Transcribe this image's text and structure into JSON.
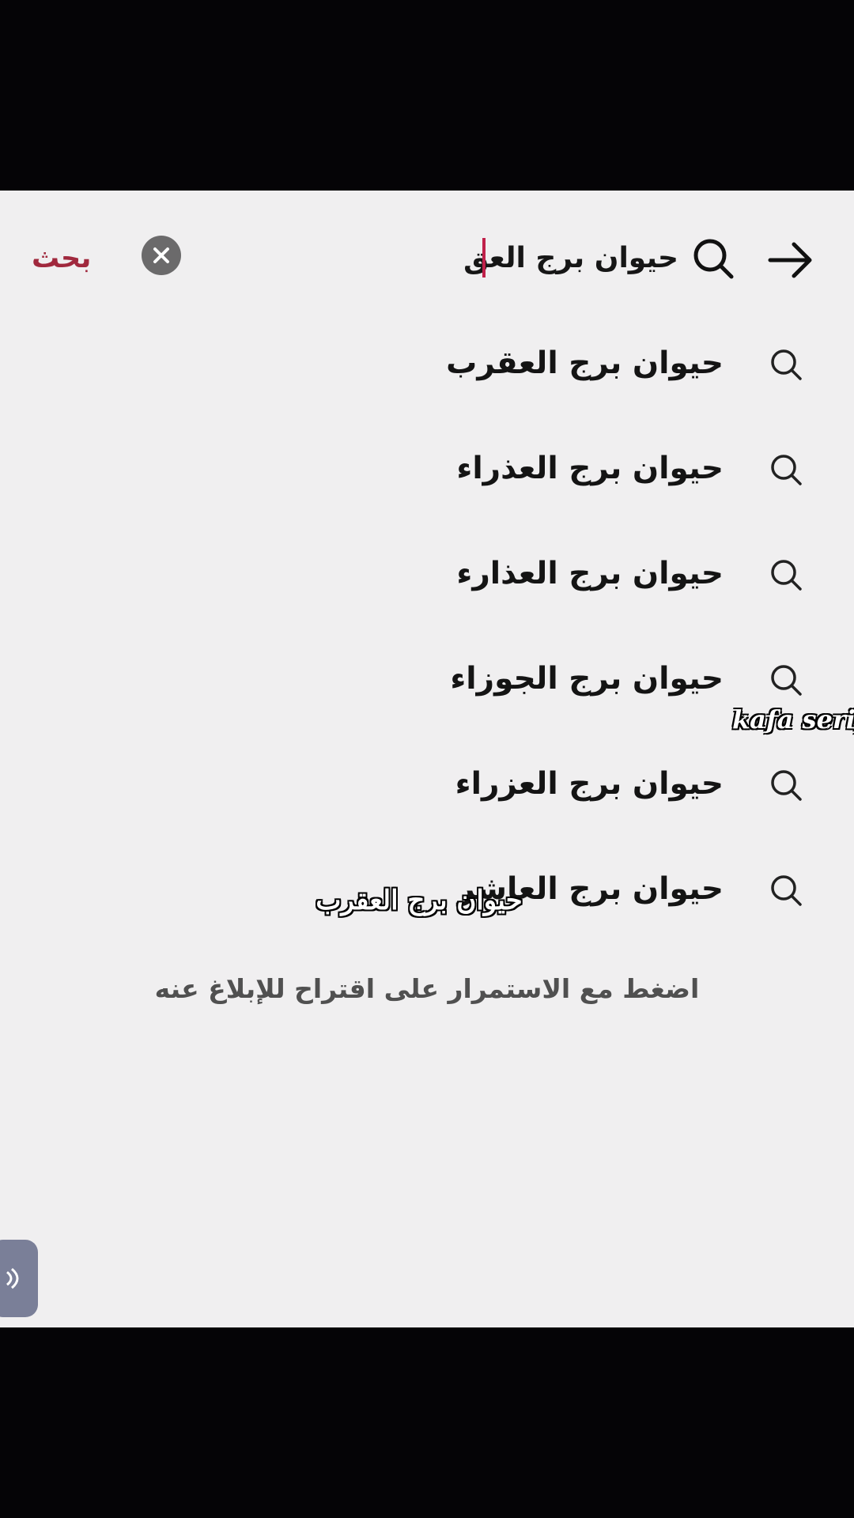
{
  "search": {
    "query": "حيوان برج العق",
    "submit_label": "بحث"
  },
  "suggestions": [
    {
      "label": "حيوان برج العقرب"
    },
    {
      "label": "حيوان برج العذراء"
    },
    {
      "label": "حيوان برج العذارء"
    },
    {
      "label": "حيوان برج الجوزاء"
    },
    {
      "label": "حيوان برج العزراء"
    },
    {
      "label": "حيوان برج العاشر"
    }
  ],
  "hint": "اضغط مع الاستمرار على اقتراح للإبلاغ عنه",
  "overlay_caption": "حيوان برج العقرب",
  "watermark": "kafa serif",
  "colors": {
    "accent": "#a0283d",
    "caret": "#c0214a",
    "background": "#f0eff0",
    "text": "#141414"
  },
  "icons": [
    "arrow-right-icon",
    "search-icon",
    "clear-icon",
    "mic-icon"
  ]
}
